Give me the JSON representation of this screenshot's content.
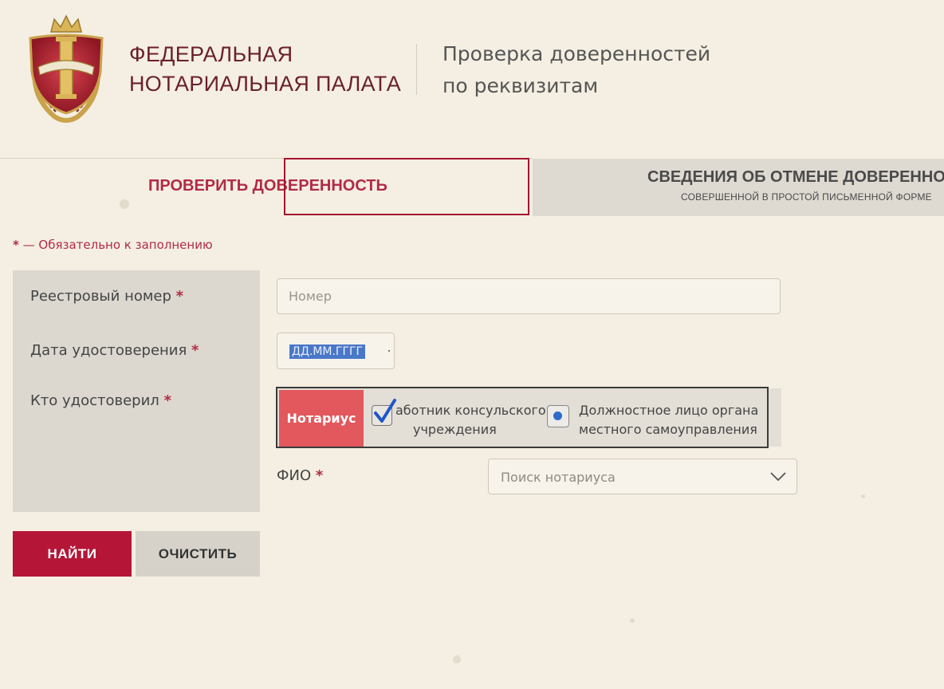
{
  "header": {
    "org_name_line1": "ФЕДЕРАЛЬНАЯ",
    "org_name_line2": "НОТАРИАЛЬНАЯ ПАЛАТА",
    "service_line1": "Проверка доверенностей",
    "service_line2": "по реквизитам"
  },
  "tabs": {
    "check": "ПРОВЕРИТЬ ДОВЕРЕННОСТЬ",
    "cancel_title": "СВЕДЕНИЯ ОБ ОТМЕНЕ ДОВЕРЕННОСТ",
    "cancel_subtitle": "СОВЕРШЕННОЙ В ПРОСТОЙ ПИСЬМЕННОЙ ФОРМЕ"
  },
  "form": {
    "required_star": "*",
    "required_note": " — Обязательно к заполнению",
    "registry_label": "Реестровый номер",
    "registry_placeholder": "Номер",
    "date_label": "Дата удостоверения",
    "date_value": "ДД.ММ.ГГГГ",
    "certifier_label": "Кто удостоверил",
    "certifier_options": {
      "notary": "Нотариус",
      "consul_line1": "аботник консульского",
      "consul_line2": "учреждения",
      "local_line1": "Должностное лицо органа",
      "local_line2": "местного самоуправления"
    },
    "fio_label": "ФИО",
    "fio_placeholder": "Поиск нотариуса"
  },
  "buttons": {
    "find": "НАЙТИ",
    "clear": "ОЧИСТИТЬ"
  },
  "colors": {
    "brand": "#b51638",
    "notary_button": "#e2585d",
    "radio_selected": "#2d6dc9"
  }
}
